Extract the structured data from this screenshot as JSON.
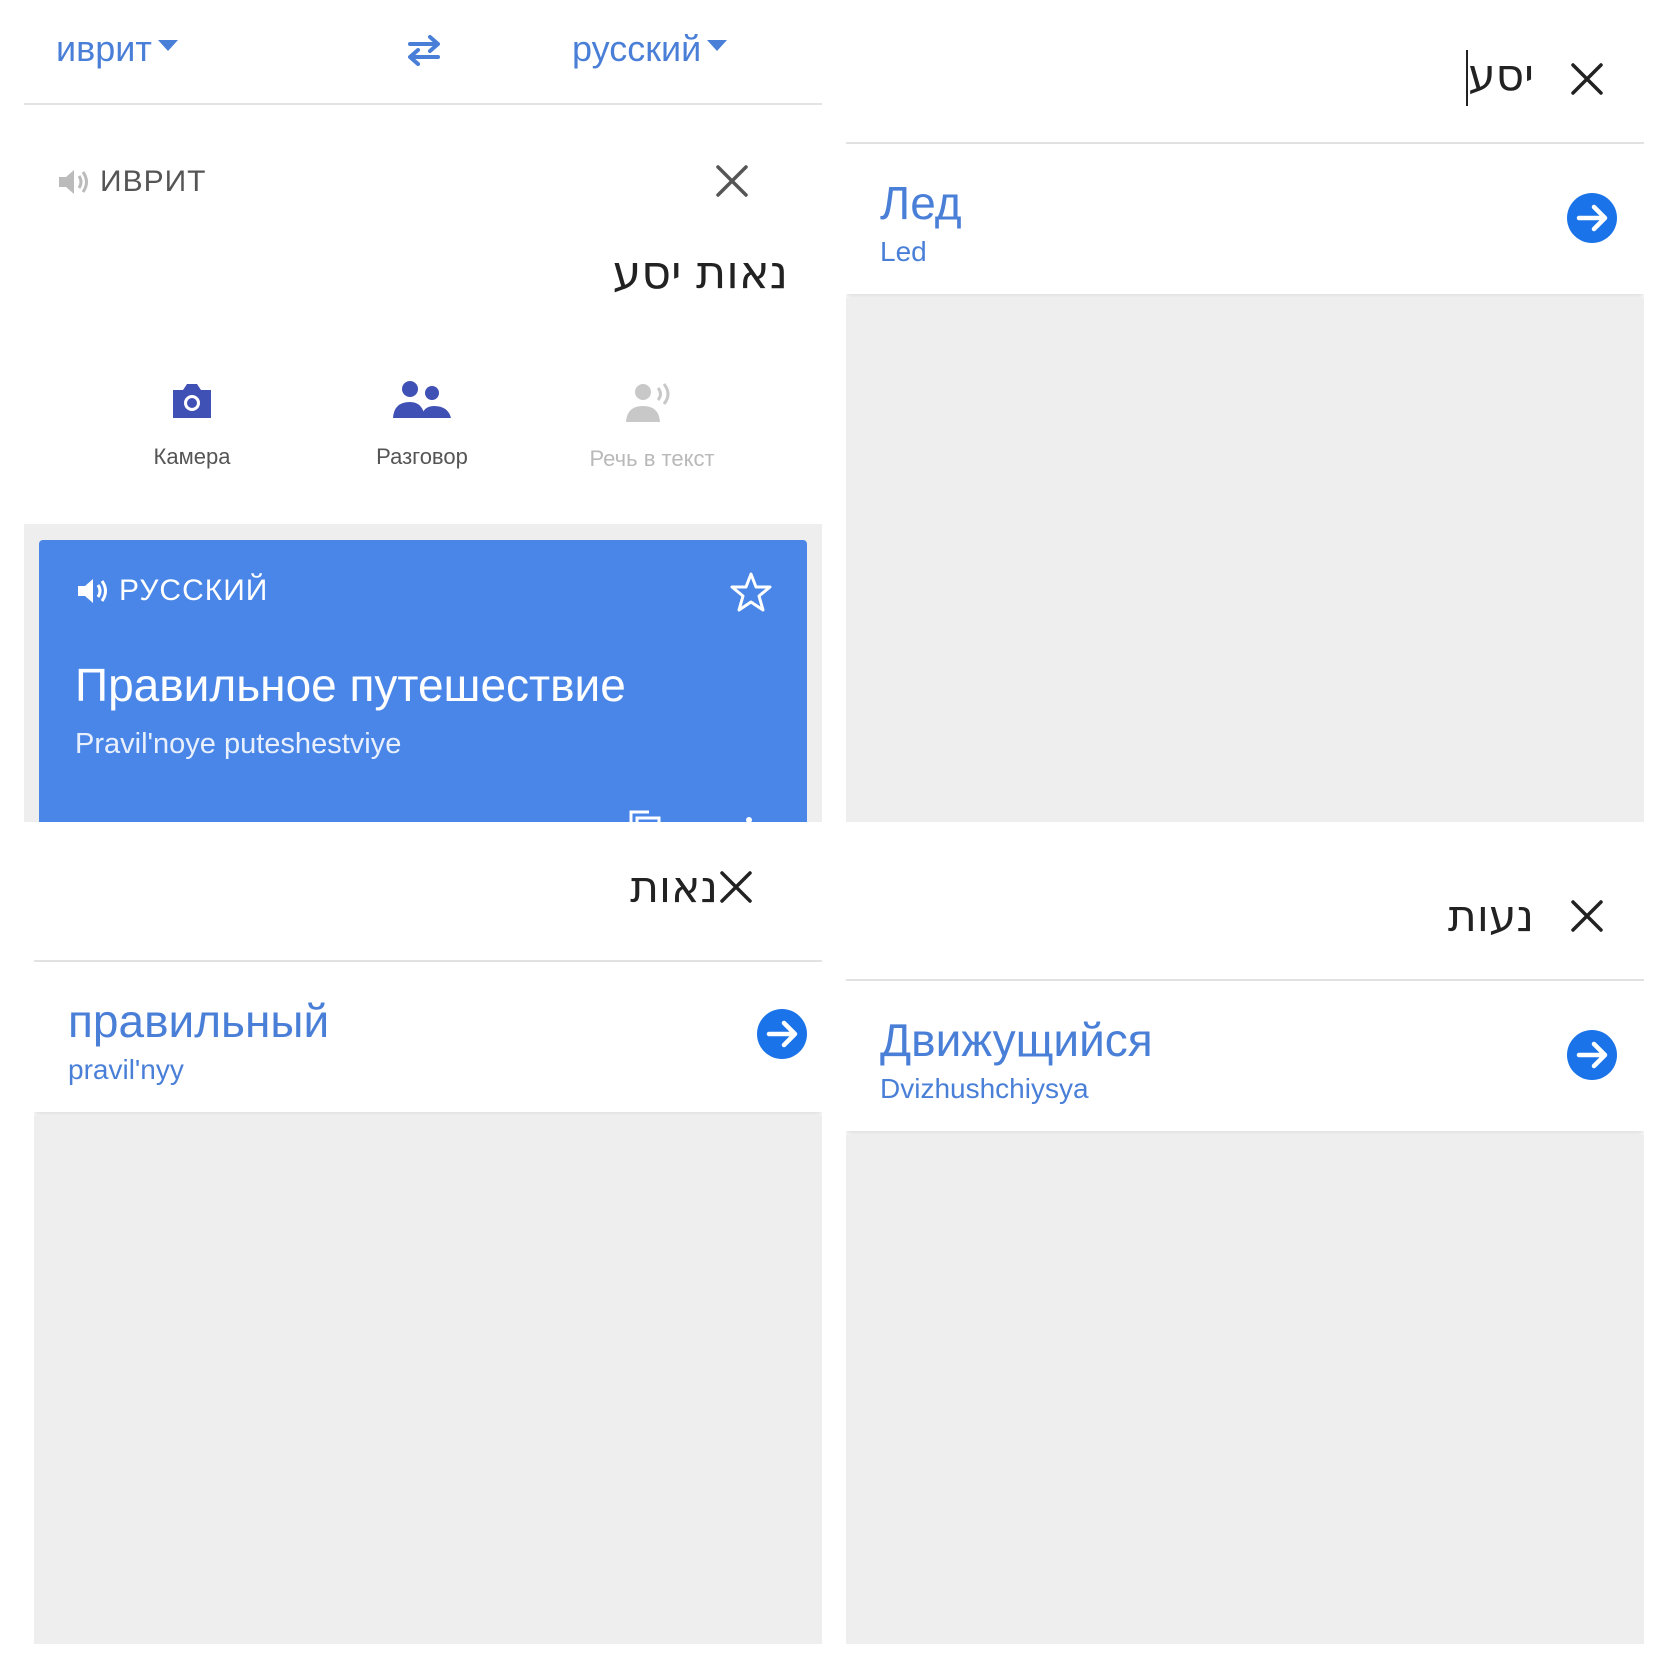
{
  "colors": {
    "accent": "#4a7fd8",
    "card": "#4a86e8",
    "divider": "#3d72cf",
    "gray": "#eeeeee"
  },
  "translate": {
    "source_lang": "иврит",
    "target_lang": "русский",
    "source_label": "ИВРИТ",
    "source_text": "נאות יסע",
    "tools": [
      {
        "label": "Камера",
        "icon": "camera-icon"
      },
      {
        "label": "Разговор",
        "icon": "conversation-icon"
      },
      {
        "label": "Речь в текст",
        "icon": "speech-to-text-icon"
      }
    ],
    "result": {
      "lang_label": "РУССКИЙ",
      "text": "Правильное путешествие",
      "transliteration": "Pravil'noye puteshestviye"
    }
  },
  "dict_panels": [
    {
      "query": "נאות",
      "word": "правильный",
      "transliteration": "pravil'nyy"
    },
    {
      "query": "יסע",
      "word": "Лед",
      "transliteration": "Led"
    },
    {
      "query": "נעות",
      "word": "Движущийся",
      "transliteration": "Dvizhushchiysya"
    }
  ]
}
